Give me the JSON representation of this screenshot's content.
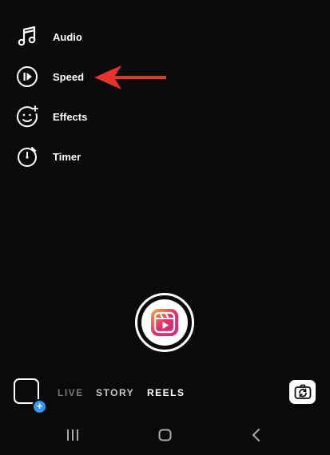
{
  "tools": [
    {
      "label": "Audio",
      "icon": "music-note-icon"
    },
    {
      "label": "Speed",
      "icon": "speed-icon"
    },
    {
      "label": "Effects",
      "icon": "effects-face-icon"
    },
    {
      "label": "Timer",
      "icon": "timer-icon"
    }
  ],
  "modes": {
    "live": "LIVE",
    "story": "STORY",
    "reels": "REELS",
    "selected": "REELS"
  },
  "gallery_plus": "+",
  "colors": {
    "background": "#0a0a0a",
    "arrow": "#e8332c",
    "plus_badge": "#3797f0",
    "reels_gradient_start": "#f9b233",
    "reels_gradient_end": "#c13584"
  }
}
